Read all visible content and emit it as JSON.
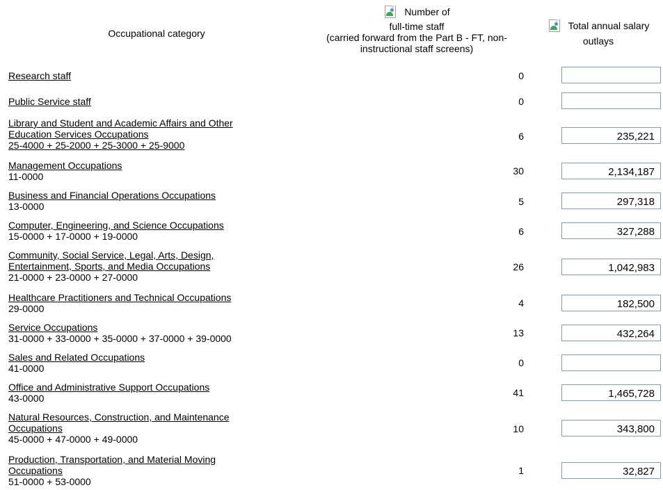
{
  "header": {
    "category_label": "Occupational category",
    "number_label_1": "Number of",
    "number_label_2": "full-time staff",
    "number_label_3": "(carried forward from the Part B - FT, non-",
    "number_label_4": "instructional staff screens)",
    "salary_label_1": "Total annual salary",
    "salary_label_2": "outlays"
  },
  "rows": [
    {
      "label_lines": [
        "Research staff"
      ],
      "code": "",
      "number": "0",
      "salary": ""
    },
    {
      "label_lines": [
        "Public Service staff"
      ],
      "code": "",
      "number": "0",
      "salary": ""
    },
    {
      "label_lines": [
        "Library and Student and Academic Affairs and Other",
        "Education Services Occupations",
        "25-4000 + 25-2000 + 25-3000 + 25-9000"
      ],
      "code": "",
      "number": "6",
      "salary": "235,221"
    },
    {
      "label_lines": [
        "Management Occupations"
      ],
      "code": "11-0000",
      "number": "30",
      "salary": "2,134,187"
    },
    {
      "label_lines": [
        "Business and Financial Operations Occupations"
      ],
      "code": "13-0000",
      "number": "5",
      "salary": "297,318"
    },
    {
      "label_lines": [
        "Computer, Engineering, and Science Occupations"
      ],
      "code": "15-0000 + 17-0000 + 19-0000",
      "number": "6",
      "salary": "327,288"
    },
    {
      "label_lines": [
        "Community, Social Service, Legal, Arts, Design,",
        "Entertainment, Sports, and Media Occupations"
      ],
      "code": "21-0000 + 23-0000 + 27-0000",
      "number": "26",
      "salary": "1,042,983"
    },
    {
      "label_lines": [
        "Healthcare Practitioners and Technical Occupations"
      ],
      "code": "29-0000",
      "number": "4",
      "salary": "182,500"
    },
    {
      "label_lines": [
        "Service Occupations"
      ],
      "code": "31-0000 + 33-0000 + 35-0000 + 37-0000 + 39-0000",
      "number": "13",
      "salary": "432,264"
    },
    {
      "label_lines": [
        "Sales and Related Occupations"
      ],
      "code": "41-0000",
      "number": "0",
      "salary": ""
    },
    {
      "label_lines": [
        "Office and Administrative Support Occupations"
      ],
      "code": "43-0000",
      "number": "41",
      "salary": "1,465,728"
    },
    {
      "label_lines": [
        "Natural Resources, Construction, and Maintenance",
        "Occupations"
      ],
      "code": "45-0000 + 47-0000 + 49-0000",
      "number": "10",
      "salary": "343,800"
    },
    {
      "label_lines": [
        "Production, Transportation, and Material Moving",
        "Occupations"
      ],
      "code": "51-0000 + 53-0000",
      "number": "1",
      "salary": "32,827"
    }
  ]
}
